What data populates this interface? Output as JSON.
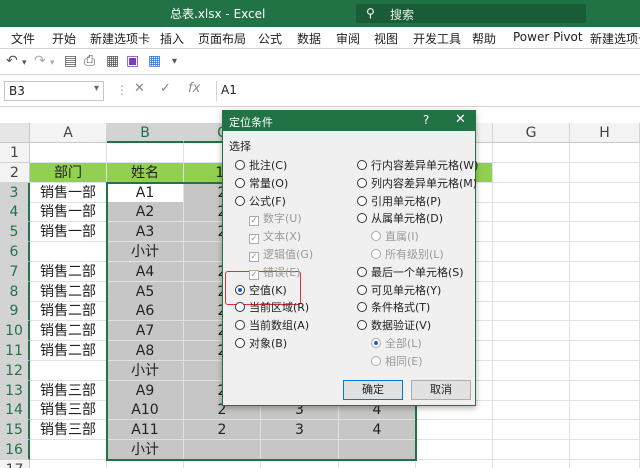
{
  "window": {
    "title": "总表.xlsx  -  Excel",
    "search_icon": "lightbulb-icon",
    "search_placeholder": "搜索"
  },
  "ribbon_tabs": [
    "文件",
    "开始",
    "新建选项卡",
    "插入",
    "页面布局",
    "公式",
    "数据",
    "审阅",
    "视图",
    "开发工具",
    "帮助",
    "Power Pivot",
    "新建选项卡"
  ],
  "quick_access": [
    "undo-icon",
    "redo-icon",
    "form-icon",
    "print-preview-icon",
    "save-icon",
    "layout-icon",
    "more-icon"
  ],
  "formula_bar": {
    "name_box": "B3",
    "cancel_symbol": "✕",
    "confirm_symbol": "✓",
    "fx_label": "fx",
    "formula_value": "A1"
  },
  "sheet": {
    "columns": [
      "A",
      "B",
      "C",
      "D",
      "E",
      "F",
      "G",
      "H"
    ],
    "row_numbers": [
      "1",
      "2",
      "3",
      "4",
      "5",
      "6",
      "7",
      "8",
      "9",
      "10",
      "11",
      "12",
      "13",
      "14",
      "15",
      "16",
      "17"
    ],
    "header_row": {
      "dept": "部门",
      "name": "姓名",
      "c_partial": "1,"
    },
    "rows": [
      {
        "dept": "销售一部",
        "name": "A1"
      },
      {
        "dept": "销售一部",
        "name": "A2"
      },
      {
        "dept": "销售一部",
        "name": "A3"
      },
      {
        "dept": "",
        "name": "小计"
      },
      {
        "dept": "销售二部",
        "name": "A4"
      },
      {
        "dept": "销售二部",
        "name": "A5"
      },
      {
        "dept": "销售二部",
        "name": "A6"
      },
      {
        "dept": "销售二部",
        "name": "A7"
      },
      {
        "dept": "销售二部",
        "name": "A8"
      },
      {
        "dept": "",
        "name": "小计"
      },
      {
        "dept": "销售三部",
        "name": "A9"
      },
      {
        "dept": "销售三部",
        "name": "A10",
        "c": "2",
        "d": "3",
        "e": "4"
      },
      {
        "dept": "销售三部",
        "name": "A11",
        "c": "2",
        "d": "3",
        "e": "4"
      },
      {
        "dept": "",
        "name": "小计"
      }
    ],
    "c_column_visible": [
      "2",
      "2",
      "2",
      "",
      "2",
      "2",
      "2",
      "2",
      "2",
      "",
      "2"
    ]
  },
  "dialog": {
    "title": "定位条件",
    "help": "?",
    "close": "✕",
    "section_label": "选择",
    "left_options": [
      {
        "label": "批注(C)",
        "type": "radio"
      },
      {
        "label": "常量(O)",
        "type": "radio"
      },
      {
        "label": "公式(F)",
        "type": "radio"
      },
      {
        "label": "数字(U)",
        "type": "check-disabled"
      },
      {
        "label": "文本(X)",
        "type": "check-disabled"
      },
      {
        "label": "逻辑值(G)",
        "type": "check-disabled"
      },
      {
        "label": "错误(E)",
        "type": "check-disabled"
      },
      {
        "label": "空值(K)",
        "type": "radio",
        "selected": true
      },
      {
        "label": "当前区域(R)",
        "type": "radio"
      },
      {
        "label": "当前数组(A)",
        "type": "radio"
      },
      {
        "label": "对象(B)",
        "type": "radio"
      }
    ],
    "right_options": [
      {
        "label": "行内容差异单元格(W)",
        "type": "radio"
      },
      {
        "label": "列内容差异单元格(M)",
        "type": "radio"
      },
      {
        "label": "引用单元格(P)",
        "type": "radio"
      },
      {
        "label": "从属单元格(D)",
        "type": "radio"
      },
      {
        "label": "直属(I)",
        "type": "radio-disabled"
      },
      {
        "label": "所有级别(L)",
        "type": "radio-disabled"
      },
      {
        "label": "最后一个单元格(S)",
        "type": "radio"
      },
      {
        "label": "可见单元格(Y)",
        "type": "radio"
      },
      {
        "label": "条件格式(T)",
        "type": "radio"
      },
      {
        "label": "数据验证(V)",
        "type": "radio"
      },
      {
        "label": "全部(L)",
        "type": "radio-disabled-on"
      },
      {
        "label": "相同(E)",
        "type": "radio-disabled"
      }
    ],
    "ok_label": "确定",
    "cancel_label": "取消"
  },
  "colors": {
    "excel_green": "#217346",
    "header_fill": "#92d050",
    "selection_fill": "#c6c6c6",
    "highlight_red": "#e03030"
  }
}
